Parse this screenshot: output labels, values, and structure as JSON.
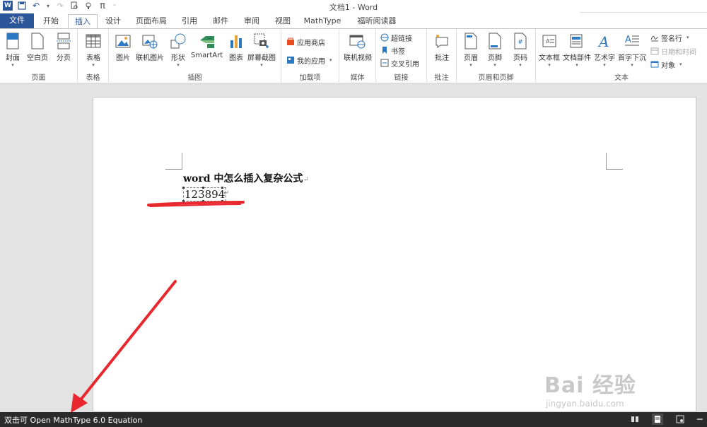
{
  "window": {
    "title": "文档1 - Word",
    "qat_icons": [
      "word-logo-icon",
      "save-icon",
      "undo-icon",
      "redo-icon",
      "print-preview-icon",
      "touch-mode-icon",
      "pi-icon",
      "customize-icon"
    ]
  },
  "tabs": [
    {
      "label": "文件"
    },
    {
      "label": "开始"
    },
    {
      "label": "插入"
    },
    {
      "label": "设计"
    },
    {
      "label": "页面布局"
    },
    {
      "label": "引用"
    },
    {
      "label": "邮件"
    },
    {
      "label": "审阅"
    },
    {
      "label": "视图"
    },
    {
      "label": "MathType"
    },
    {
      "label": "福昕阅读器"
    }
  ],
  "active_tab": "插入",
  "ribbon": {
    "groups": {
      "pages": {
        "label": "页面",
        "buttons": [
          "封面",
          "空白页",
          "分页"
        ]
      },
      "tables": {
        "label": "表格",
        "buttons": [
          "表格"
        ]
      },
      "illustrations": {
        "label": "插图",
        "buttons": [
          "图片",
          "联机图片",
          "形状",
          "SmartArt",
          "图表",
          "屏幕截图"
        ]
      },
      "addins": {
        "label": "加载项",
        "buttons": [
          "应用商店",
          "我的应用"
        ]
      },
      "media": {
        "label": "媒体",
        "buttons": [
          "联机视频"
        ]
      },
      "links": {
        "label": "链接",
        "buttons": [
          "超链接",
          "书签",
          "交叉引用"
        ]
      },
      "comments": {
        "label": "批注",
        "buttons": [
          "批注"
        ]
      },
      "header_footer": {
        "label": "页眉和页脚",
        "buttons": [
          "页眉",
          "页脚",
          "页码"
        ]
      },
      "text": {
        "label": "文本",
        "buttons": [
          "文本框",
          "文档部件",
          "艺术字",
          "首字下沉",
          "签名行",
          "日期和时间",
          "对象"
        ]
      }
    }
  },
  "document": {
    "title": "word 中怎么插入复杂公式",
    "paragraph_mark": "↵",
    "equation": "123894"
  },
  "status_bar": {
    "text": "双击可 Open MathType 6.0 Equation"
  },
  "watermark": {
    "main": "Bai 经验",
    "sub": "jingyan.baidu.com"
  },
  "colors": {
    "accent": "#2b579a",
    "annotation": "#e8282e",
    "status_bg": "#2b2b2b"
  }
}
